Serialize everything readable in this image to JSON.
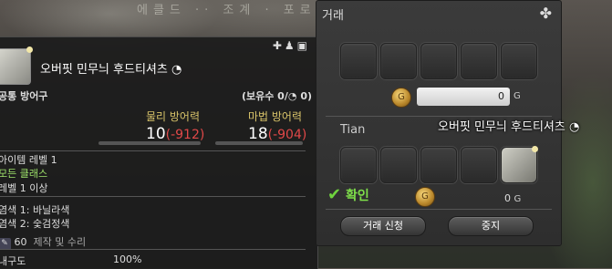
{
  "item": {
    "name": "오버핏 민무늬 후드티셔츠",
    "category": "공통 방어구",
    "owned": "(보유수 0/",
    "owned_end": "0)",
    "phys_label": "물리 방어력",
    "phys_value": "10",
    "phys_diff": "(-912)",
    "mag_label": "마법 방어력",
    "mag_value": "18",
    "mag_diff": "(-904)",
    "item_level": "아이템 레벨 1",
    "classes": "모든 클래스",
    "req_level": "레벨 1 이상",
    "dye1": "염색 1: 바닐라색",
    "dye2": "염색 2: 숯검정색",
    "craft_level": "60",
    "craft_label": "제작 및 수리",
    "durability_label": "내구도",
    "durability_value": "100%"
  },
  "trade": {
    "title": "거래",
    "my_gil": "0",
    "gil_unit": "G",
    "partner_name": "Tian",
    "partner_item_name": "오버핏 민무늬 후드티셔츠",
    "confirm_label": "확인",
    "partner_gil": "0",
    "trade_button": "거래 신청",
    "cancel_button": "중지"
  },
  "background_text": "에클드 ·· 조계 · 포로라로"
}
